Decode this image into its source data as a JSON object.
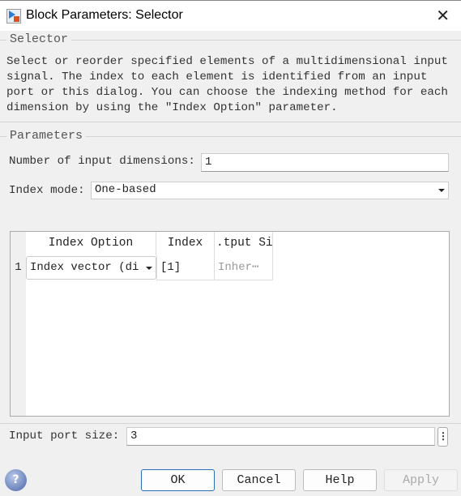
{
  "window": {
    "title": "Block Parameters: Selector"
  },
  "selector_group": {
    "legend": "Selector",
    "description": "Select or reorder specified elements of a multidimensional input signal. The index to each element is identified from an input port or this dialog. You can choose the indexing method for each dimension by using the \"Index Option\" parameter."
  },
  "parameters": {
    "legend": "Parameters",
    "num_dims_label": "Number of input dimensions:",
    "num_dims_value": "1",
    "index_mode_label": "Index mode:",
    "index_mode_value": "One-based",
    "table": {
      "headers": [
        "Index Option",
        "Index",
        ".tput Si"
      ],
      "rows": [
        {
          "num": "1",
          "index_option": "Index vector (di",
          "index": "[1]",
          "output_size": "Inher⋯"
        }
      ]
    },
    "port_size_label": "Input port size:",
    "port_size_value": "3"
  },
  "buttons": {
    "ok": "OK",
    "cancel": "Cancel",
    "help": "Help",
    "apply": "Apply"
  }
}
